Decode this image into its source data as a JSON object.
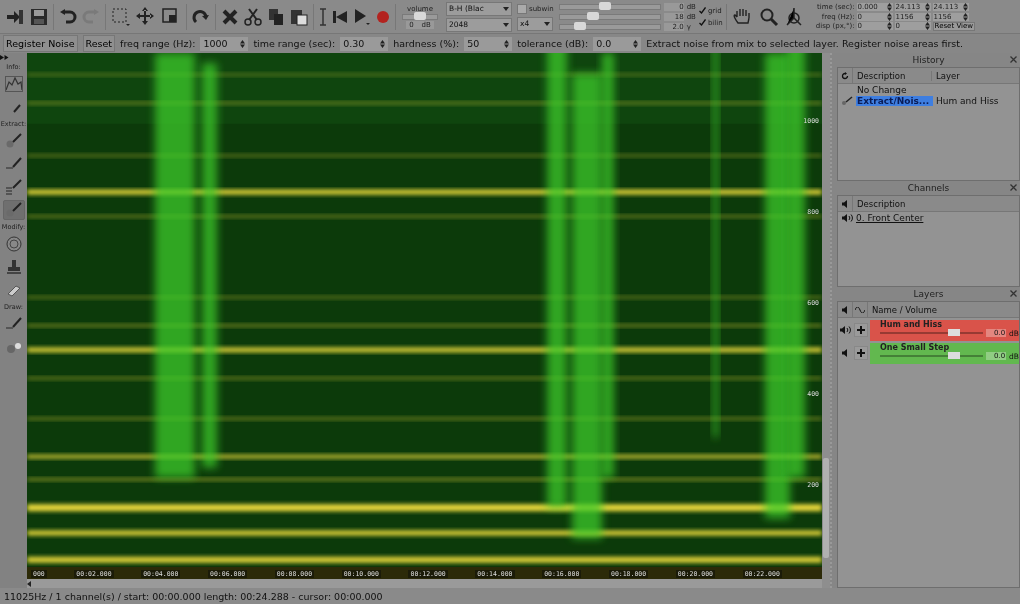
{
  "toolbar": {
    "volume": {
      "label": "volume",
      "level": 0.5,
      "value": "0",
      "unit": "dB"
    },
    "window_select": {
      "value": "B-H (Blac"
    },
    "fft_select": {
      "value": "2048"
    },
    "oversample_select": {
      "value": "x4"
    },
    "subwin": {
      "label": "subwin",
      "checked": false
    },
    "sliders": [
      {
        "level": 0.45,
        "value": "0",
        "unit": "dB"
      },
      {
        "level": 0.33,
        "value": "18",
        "unit": "dB"
      },
      {
        "level": 0.2,
        "value": "2.0",
        "unit": "γ"
      }
    ],
    "checks": [
      {
        "label": "grid",
        "checked": true
      },
      {
        "label": "bilin",
        "checked": true
      }
    ],
    "view": [
      {
        "label": "time (sec):",
        "values": [
          "0.000",
          "24.113",
          "24.113"
        ]
      },
      {
        "label": "freq (Hz):",
        "values": [
          "0",
          "1156",
          "1156"
        ]
      },
      {
        "label": "disp (px,°):",
        "values": [
          "0",
          "0"
        ]
      }
    ],
    "reset_view": "Reset View"
  },
  "tool_options": {
    "buttons": [
      "Register Noise",
      "Reset"
    ],
    "fields": [
      {
        "label": "freq range (Hz):",
        "value": "1000"
      },
      {
        "label": "time range (sec):",
        "value": "0.30"
      },
      {
        "label": "hardness (%):",
        "value": "50"
      },
      {
        "label": "tolerance (dB):",
        "value": "0.0"
      }
    ],
    "hint": "Extract noise from mix to selected layer. Register noise areas first."
  },
  "tools": [
    {
      "label": "Info:",
      "items": [
        {
          "kind": "spectrum",
          "selected": false
        },
        {
          "kind": "pen",
          "selected": false
        }
      ]
    },
    {
      "label": "Extract:",
      "items": [
        {
          "kind": "dot-brush",
          "selected": false
        },
        {
          "kind": "line-brush",
          "selected": false
        },
        {
          "kind": "stack-brush",
          "selected": false
        },
        {
          "kind": "dot-brush",
          "selected": true
        }
      ]
    },
    {
      "label": "Modify:",
      "items": [
        {
          "kind": "ring",
          "selected": false
        },
        {
          "kind": "stamp",
          "selected": false
        },
        {
          "kind": "eraser",
          "selected": false
        }
      ]
    },
    {
      "label": "Draw:",
      "items": [
        {
          "kind": "line-brush",
          "selected": false
        },
        {
          "kind": "spray",
          "selected": false
        }
      ]
    }
  ],
  "spectrogram": {
    "freq_labels": [
      "1000",
      "800",
      "600",
      "400",
      "200"
    ],
    "time_labels": [
      "000",
      "00:02.000",
      "00:04.000",
      "00:06.000",
      "00:08.000",
      "00:10.000",
      "00:12.000",
      "00:14.000",
      "00:16.000",
      "00:18.000",
      "00:20.000",
      "00:22.000"
    ]
  },
  "history": {
    "title": "History",
    "columns": [
      "Description",
      "Layer"
    ],
    "rows": [
      {
        "kind": "initial",
        "description": "No Change",
        "layer": "",
        "selected": false
      },
      {
        "kind": "tool",
        "description": "Extract/Nois...",
        "layer": "Hum and Hiss",
        "selected": true
      }
    ]
  },
  "channels": {
    "title": "Channels",
    "columns": [
      "Description"
    ],
    "rows": [
      {
        "name": "0. Front Center"
      }
    ]
  },
  "layers": {
    "title": "Layers",
    "columns": [
      "Name / Volume"
    ],
    "rows": [
      {
        "name": "Hum and Hiss",
        "color": "#d9534a",
        "level": 0.72,
        "value": "0.0",
        "unit": "dB",
        "sound_on": true
      },
      {
        "name": "One Small Step",
        "color": "#62b84f",
        "level": 0.72,
        "value": "0.0",
        "unit": "dB",
        "sound_on": false
      }
    ]
  },
  "status_bar": "11025Hz / 1 channel(s) / start: 00:00.000 length:  00:24.288 - cursor:  00:00.000"
}
